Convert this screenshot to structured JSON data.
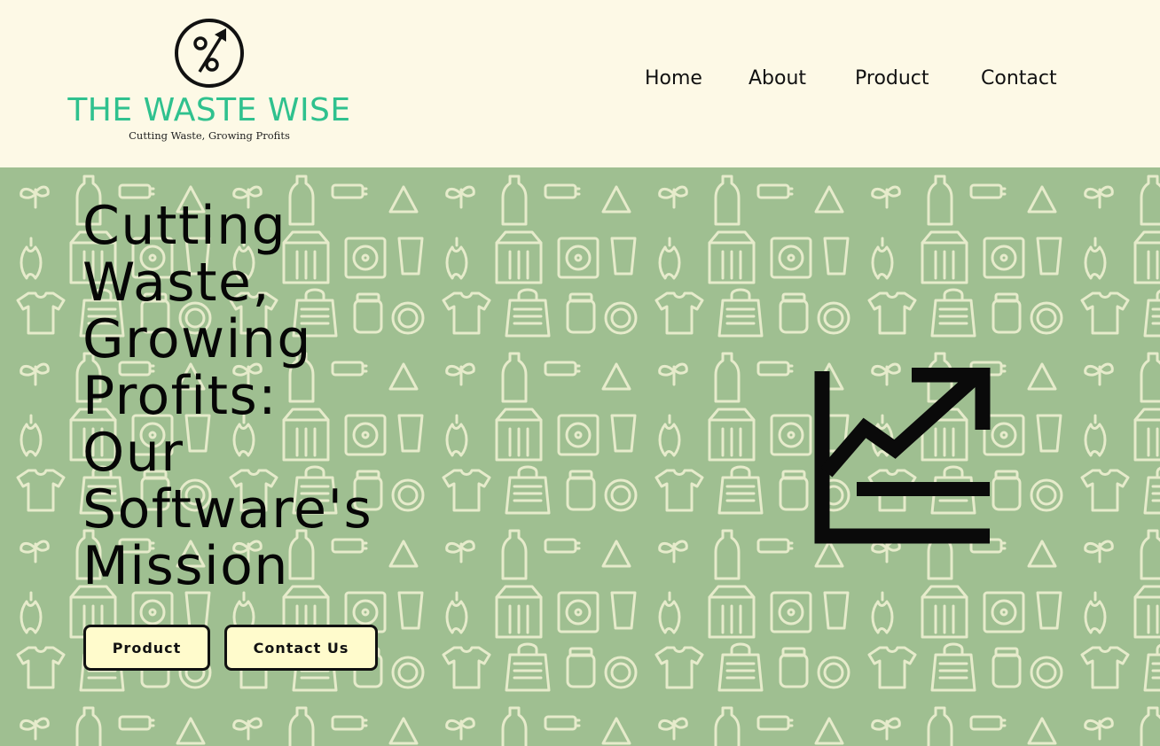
{
  "brand": {
    "name": "THE WASTE WISE",
    "tagline": "Cutting Waste, Growing Profits",
    "logo_icon": "percent-growth-icon",
    "accent_color": "#2fc18e"
  },
  "nav": {
    "items": [
      {
        "label": "Home"
      },
      {
        "label": "About"
      },
      {
        "label": "Product"
      },
      {
        "label": "Contact"
      }
    ]
  },
  "hero": {
    "title_lines": [
      "Cutting",
      "Waste,",
      "Growing",
      "Profits:",
      "Our",
      "Software's",
      "Mission"
    ],
    "buttons": {
      "product_label": "Product",
      "contact_label": "Contact Us"
    },
    "background_color": "#9fbf91",
    "pattern_color": "#e6ebcb",
    "illustration_icon": "growth-chart-icon"
  },
  "colors": {
    "header_bg": "#fdf9e6",
    "button_bg": "#fffbcc",
    "text": "#111111"
  }
}
